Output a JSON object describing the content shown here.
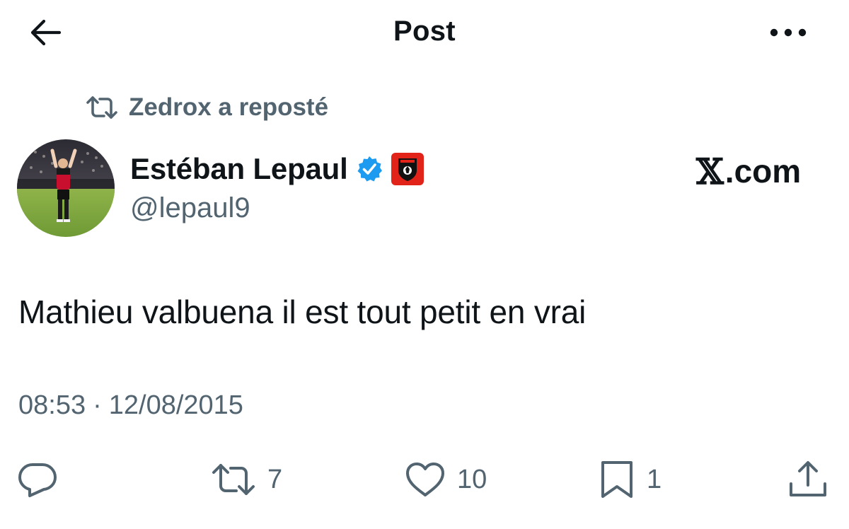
{
  "header": {
    "title": "Post",
    "back_icon": "arrow-left-icon",
    "more_icon": "more-horizontal-icon"
  },
  "repost": {
    "icon": "repost-icon",
    "label": "Zedrox a reposté"
  },
  "author": {
    "name": "Estéban Lepaul",
    "handle": "@lepaul9",
    "verified_icon": "verified-badge-icon",
    "affiliation_icon": "club-crest-icon",
    "verified_color": "#1d9bf0",
    "affiliation_color": "#e2231a"
  },
  "watermark": {
    "mark": "𝕏",
    "text": ".com"
  },
  "post": {
    "text": "Mathieu valbuena il est tout petit en vrai",
    "time": "08:53",
    "separator": "·",
    "date": "12/08/2015"
  },
  "actions": {
    "reply": {
      "icon": "reply-icon",
      "count": ""
    },
    "repost": {
      "icon": "repost-icon",
      "count": "7"
    },
    "like": {
      "icon": "heart-icon",
      "count": "10"
    },
    "bookmark": {
      "icon": "bookmark-icon",
      "count": "1"
    },
    "share": {
      "icon": "share-icon",
      "count": ""
    }
  },
  "colors": {
    "text": "#0f1419",
    "secondary": "#536471",
    "background": "#ffffff"
  }
}
